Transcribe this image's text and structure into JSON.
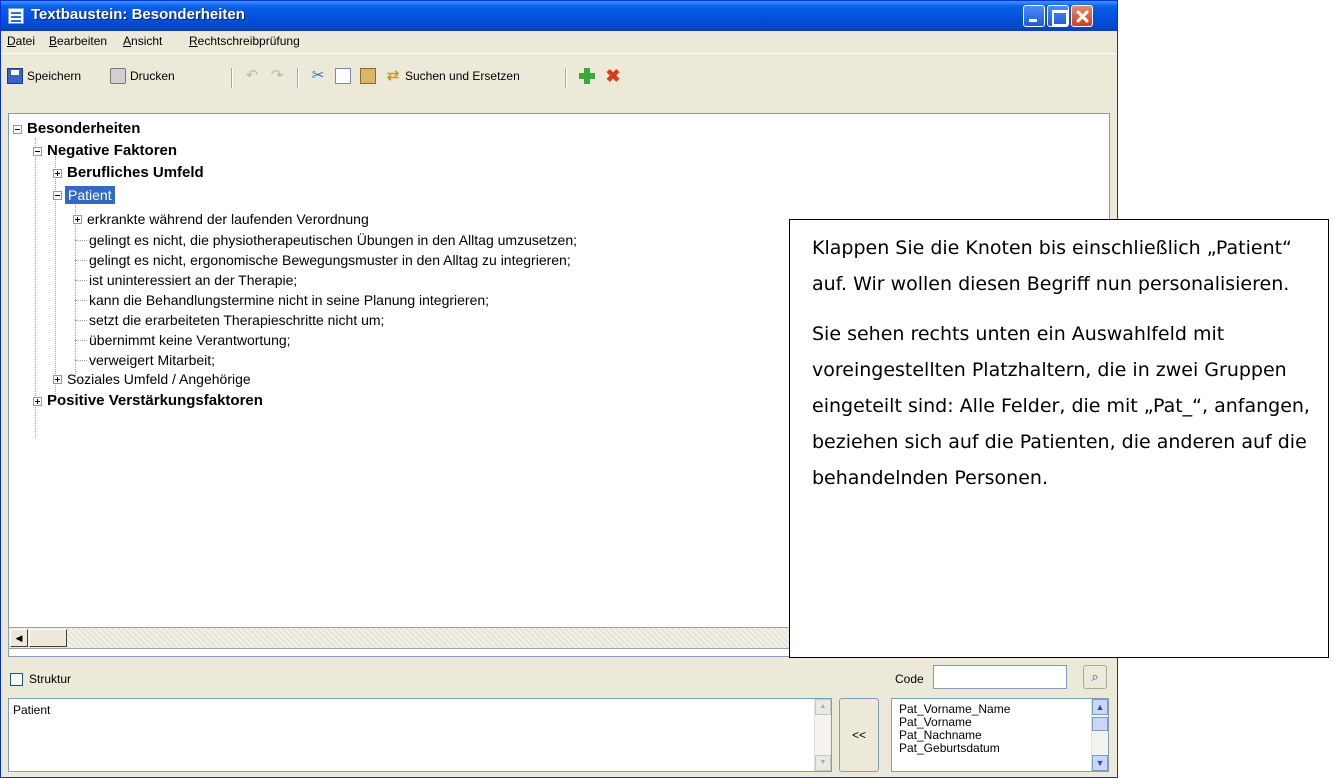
{
  "window": {
    "title": "Textbaustein: Besonderheiten"
  },
  "menu": [
    "Datei",
    "Bearbeiten",
    "Ansicht",
    "Rechtschreibprüfung"
  ],
  "toolbar": {
    "save": "Speichern",
    "print": "Drucken",
    "find_replace": "Suchen und Ersetzen"
  },
  "tree": {
    "root": "Besonderheiten",
    "negative": "Negative Faktoren",
    "berufliches": "Berufliches Umfeld",
    "patient": "Patient",
    "items": [
      "erkrankte während der laufenden Verordnung",
      "gelingt es nicht, die physiotherapeutischen Übungen in den Alltag umzusetzen;",
      "gelingt es nicht, ergonomische Bewegungsmuster in den Alltag zu integrieren;",
      "ist uninteressiert an der Therapie;",
      "kann die Behandlungstermine nicht in seine Planung integrieren;",
      "setzt die erarbeiteten Therapieschritte nicht um;",
      "übernimmt keine Verantwortung;",
      "verweigert Mitarbeit;"
    ],
    "soziales": "Soziales Umfeld / Angehörige",
    "positive": "Positive Verstärkungsfaktoren"
  },
  "bottom": {
    "struktur_label": "Struktur",
    "code_label": "Code",
    "code_value": "",
    "text_value": "Patient",
    "insert_label": "<<",
    "placeholders": [
      "Pat_Vorname_Name",
      "Pat_Vorname",
      "Pat_Nachname",
      "Pat_Geburtsdatum"
    ]
  },
  "callout": {
    "p1": "Klappen Sie die Knoten bis einschließlich „Patient“ auf.  Wir wollen diesen Begriff nun personalisieren.",
    "p2": "Sie sehen rechts unten ein Auswahlfeld mit voreingestellten Platzhaltern, die in zwei Gruppen eingeteilt sind:  Alle Felder, die mit „Pat_“, anfangen, beziehen sich auf die Patienten, die anderen auf  die behandelnden Personen."
  },
  "colors": {
    "titlebar": "#0553df",
    "selection": "#316ac5",
    "window_bg": "#ece9d8"
  }
}
